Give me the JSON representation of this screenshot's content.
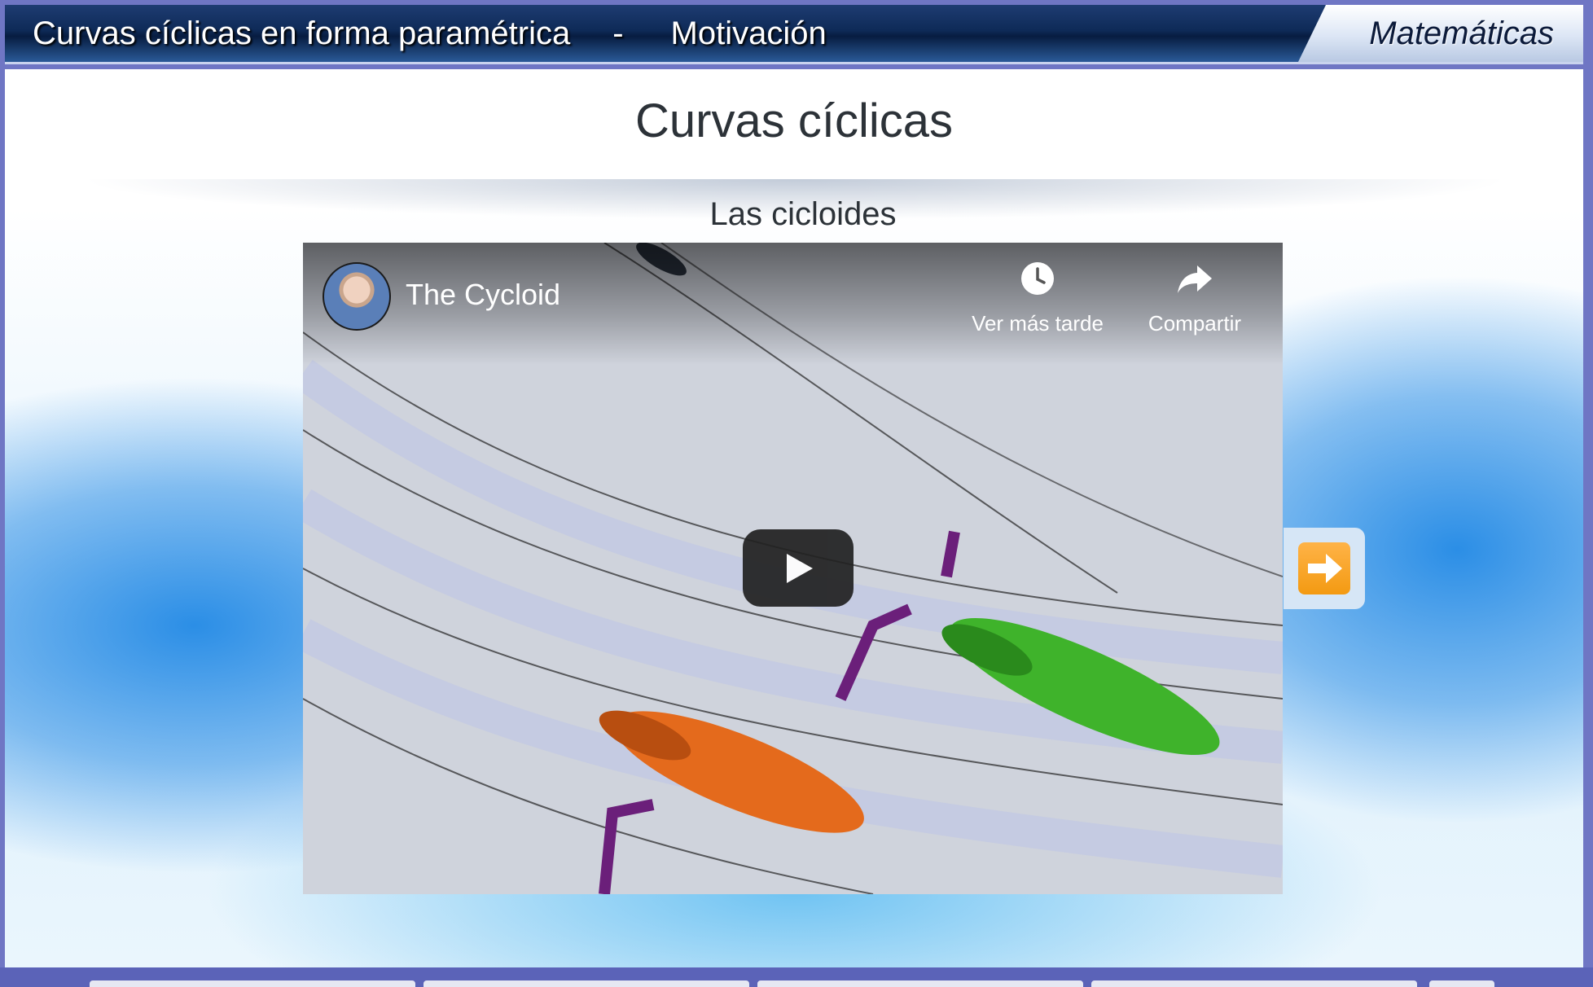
{
  "header": {
    "course_title": "Curvas cíclicas en forma paramétrica",
    "separator": "-",
    "section": "Motivación",
    "subject": "Matemáticas"
  },
  "main": {
    "title": "Curvas cíclicas",
    "subtitle": "Las cicloides"
  },
  "video": {
    "title": "The Cycloid",
    "watch_later_label": "Ver más tarde",
    "share_label": "Compartir",
    "icons": [
      "channel-avatar",
      "clock-icon",
      "share-icon",
      "play-icon"
    ]
  },
  "navigation": {
    "next_icon": "arrow-right-icon",
    "next_color": "#f39a12"
  },
  "colors": {
    "frame": "#5b63b8",
    "header_dark": "#0e2a57",
    "title_text": "#2c3238",
    "background_blue": "#2b8ee6"
  }
}
